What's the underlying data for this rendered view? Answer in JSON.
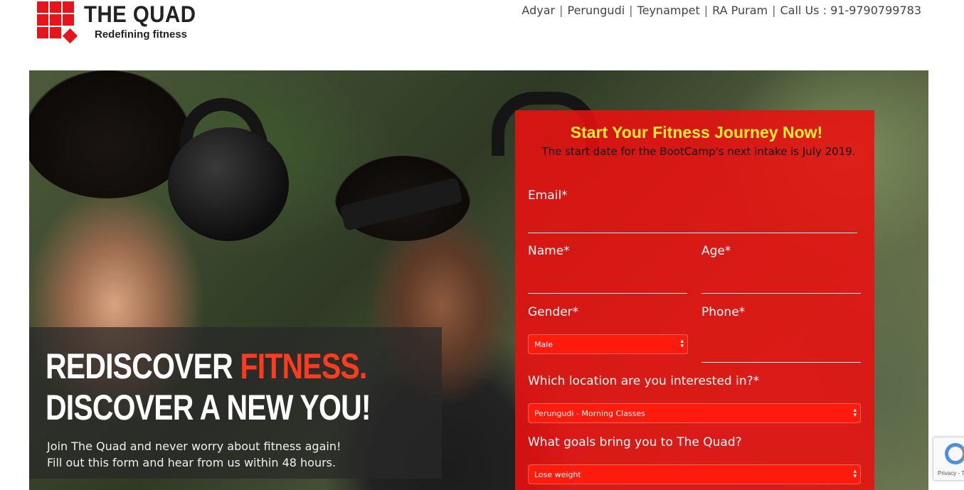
{
  "header": {
    "logo_title": "THE QUAD",
    "logo_tagline": "Redefining fitness",
    "nav": [
      "Adyar",
      "Perungudi",
      "Teynampet",
      "RA Puram"
    ],
    "call_us": "Call Us : 91-9790799783"
  },
  "hero": {
    "headline_part1": "REDISCOVER ",
    "headline_accent": "FITNESS.",
    "headline_line2": "DISCOVER A NEW YOU!",
    "subtext_line1": "Join The Quad and never worry about fitness again!",
    "subtext_line2": "Fill out this form and hear from us within 48 hours.",
    "accent_color": "#ff3b1f"
  },
  "form": {
    "title": "Start Your Fitness Journey Now!",
    "subtitle": "The start date for the BootCamp's next intake is July 2019.",
    "email_label": "Email*",
    "name_label": "Name*",
    "age_label": "Age*",
    "gender_label": "Gender*",
    "gender_value": "Male",
    "phone_label": "Phone*",
    "location_label": "Which location are you interested in?*",
    "location_value": "Perungudi - Morning Classes",
    "goals_label": "What goals bring you to The Quad?",
    "goals_value": "Lose weight",
    "panel_color": "#ea1010",
    "title_color": "#ffee2b"
  },
  "captcha": {
    "text": "Privacy - T"
  }
}
